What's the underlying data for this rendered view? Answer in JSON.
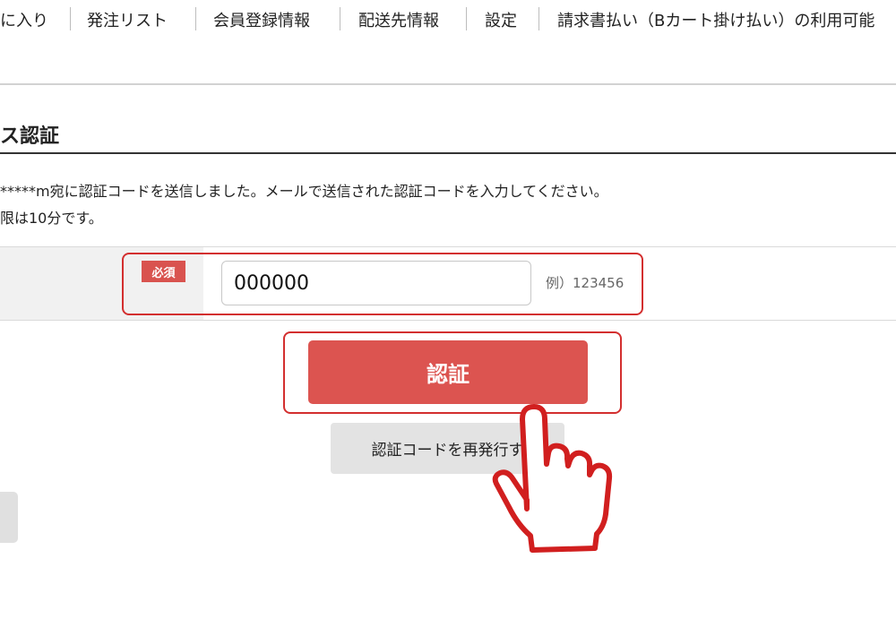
{
  "nav": {
    "items": [
      "に入り",
      "発注リスト",
      "会員登録情報",
      "配送先情報",
      "設定",
      "請求書払い（Bカート掛け払い）の利用可能"
    ]
  },
  "page": {
    "title": "ス認証",
    "message_line1": "*****m宛に認証コードを送信しました。メールで送信された認証コードを入力してください。",
    "message_line2": "限は10分です。"
  },
  "form": {
    "required_badge": "必須",
    "code_value": "000000",
    "example_text": "例）123456"
  },
  "buttons": {
    "authenticate": "認証",
    "resend": "認証コードを再発行す"
  },
  "colors": {
    "accent": "#dc5450",
    "highlight": "#d32f2f"
  },
  "icons": {
    "pointer": "pointing-hand-icon"
  }
}
